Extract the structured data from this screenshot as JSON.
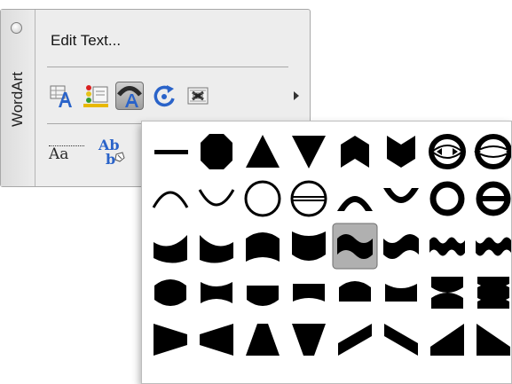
{
  "toolbar": {
    "title": "WordArt",
    "edit_text_label": "Edit Text...",
    "buttons": [
      {
        "icon": "wordart-gallery-icon"
      },
      {
        "icon": "format-wordart-icon"
      },
      {
        "icon": "wordart-shape-icon",
        "active": true
      },
      {
        "icon": "rotate-icon"
      },
      {
        "icon": "text-wrapping-icon"
      }
    ],
    "more_arrow_icon": "triangle-right-icon",
    "row2": {
      "same_height_label": "Aa",
      "vertical_text_label_top": "Ab",
      "vertical_text_label_bottom": "b"
    }
  },
  "shape_gallery": {
    "selected_index": 20,
    "shapes": [
      "plain-text",
      "stop",
      "triangle-up",
      "triangle-down",
      "chevron-up",
      "chevron-down",
      "ring-inside",
      "ring-outside",
      "arch-up-curve",
      "arch-down-curve",
      "circle-curve",
      "button-curve",
      "arch-up-pour",
      "arch-down-pour",
      "circle-pour",
      "button-pour",
      "curve-up",
      "curve-down",
      "can-up",
      "can-down",
      "wave-1",
      "wave-2",
      "double-wave-1",
      "double-wave-2",
      "inflate",
      "deflate",
      "inflate-bottom",
      "deflate-bottom",
      "inflate-top",
      "deflate-top",
      "deflate-inflate",
      "deflate-inflate-deflate",
      "fade-right",
      "fade-left",
      "fade-up",
      "fade-down",
      "slant-up",
      "slant-down",
      "cascade-up",
      "cascade-down"
    ]
  },
  "colors": {
    "panel_bg": "#ededed",
    "selected_cell": "#b0b0b0",
    "shape_fill": "#000000",
    "accent_blue": "#2a63c9"
  }
}
